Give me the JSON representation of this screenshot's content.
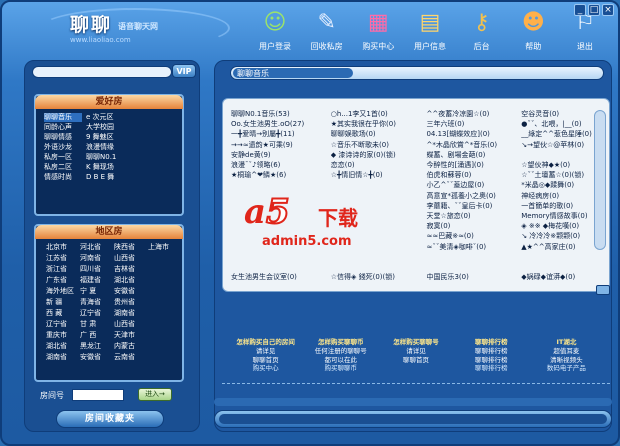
{
  "app": {
    "logo": "聊聊",
    "logo_sub": "语音聊天网",
    "logo_url": "www.liaoliao.com"
  },
  "toolbar": {
    "items": [
      {
        "label": "用户登录",
        "icon": "user-login-icon",
        "glyph": "☺"
      },
      {
        "label": "回收私房",
        "icon": "chair-icon",
        "glyph": "✎"
      },
      {
        "label": "购买中心",
        "icon": "shopping-bag-icon",
        "glyph": "▦"
      },
      {
        "label": "用户信息",
        "icon": "user-info-icon",
        "glyph": "▤"
      },
      {
        "label": "后台",
        "icon": "keys-icon",
        "glyph": "⚷"
      },
      {
        "label": "帮助",
        "icon": "help-icon",
        "glyph": "☻"
      },
      {
        "label": "退出",
        "icon": "exit-icon",
        "glyph": "⚐"
      }
    ]
  },
  "window": {
    "minimize": "_",
    "maximize": "□",
    "close": "×"
  },
  "left": {
    "vip": "VIP",
    "hobby_title": "爱好房",
    "hobby_rooms": [
      "聊聊音乐",
      "e 次元区",
      "同龄心声",
      "大学校园",
      "聊聊情感",
      "9 舞魅区",
      "外语沙龙",
      "浪漫情缘",
      "私房一区",
      "聊聊N0.1",
      "私房二区",
      "K 舞现场",
      "情感时尚",
      "D B E 舞"
    ],
    "region_title": "地区房",
    "region_rooms": [
      "北京市",
      "河北省",
      "陕西省",
      "上海市",
      "江苏省",
      "河南省",
      "山西省",
      "",
      "浙江省",
      "四川省",
      "吉林省",
      "",
      "广东省",
      "福建省",
      "湖北省",
      "",
      "海外地区",
      "宁 夏",
      "安徽省",
      "",
      "新 疆",
      "青海省",
      "贵州省",
      "",
      "西 藏",
      "辽宁省",
      "湖南省",
      "",
      "辽宁省",
      "甘 肃",
      "山西省",
      "",
      "重庆市",
      "广 西",
      "天津市",
      "",
      "湖北省",
      "黑龙江",
      "内蒙古",
      "",
      "湖南省",
      "安徽省",
      "云南省",
      ""
    ],
    "room_label": "房间号",
    "enter_button": "进入→",
    "favorites": "房间收藏夹"
  },
  "right": {
    "title": "聊聊音乐",
    "rooms": [
      [
        "聊聊N0.1音乐(53)",
        "Oo.女生池男生.oO(27)",
        "一╋爱晴→别屬╋(11)",
        "→→≈遗韵★可乘(9)",
        "安静de黄(9)",
        "浪漫ˉˇ♪领略(6)",
        "★桐瑜^❤鳞★(6)",
        "",
        "",
        "",
        "",
        "",
        "",
        "",
        "",
        "",
        "女生池男生会议室(0)"
      ],
      [
        "○h...1李又1首(0)",
        "★其实我很在乎你(0)",
        "聊聊娱歌场(0)",
        "☆音乐不断歌未(0)",
        "◆ 漆诗诗的家(0)(锁)",
        "恋恋(0)",
        "☆╋情旧情☆╋(0)",
        "",
        "",
        "",
        "",
        "",
        "",
        "",
        "",
        "",
        "☆信得◈ 錢死(0)(锁)"
      ],
      [
        "^^夜蓄冷凉園☆(0)",
        "三年六班(0)",
        "04.13[蝴蝶效应](0)",
        "^*木晶欣賞^*音乐(0)",
        "蝶蓄、剧場金葩(0)",
        "今醉性的[涌遇](0)",
        "伯虎和蘇蓉(0)",
        "小乙^ˇˇ蓋边屋(0)",
        "高意宣*孤養小之奧(0)",
        "李蘑籍、ˇˇ皇后卡(0)",
        "天堂☆旅恋(0)",
        "寂寞(0)",
        "≈≈巴藏※≈(0)",
        "≈ˇˇ美清◈咖啡ˇ(0)",
        "",
        "",
        "中国民乐3(0)"
      ],
      [
        "空谷灵音(0)",
        "●ˇˇ、北喂，|__(0)",
        "__綠定^^惹色星陲(0)",
        "↘→望伙☆@苹林(0)",
        "",
        "☆望伙神◆★(0)",
        "☆ˇˇ土壇蓄☆(0)(锁)",
        "*米晶◎◆蹂舞(0)",
        "神经病房(0)",
        "一首簡单的歌(0)",
        "Memory情感故事(0)",
        "◈ ※※ ◆梅花嘆(0)",
        "↘ 冷冷冷※颗颗(0)",
        "▲★^^高家庄(0)",
        "",
        "",
        "◆娲碌◆谊漭◆(0)"
      ]
    ],
    "services": [
      {
        "head": "怎样购买自己的房间",
        "lines": [
          "请详见",
          "聊聊首页"
        ],
        "foot": "购买中心"
      },
      {
        "head": "怎样购买聊聊币",
        "lines": [
          "任何注册的聊聊号",
          "都可以在此"
        ],
        "foot": "购买聊聊币"
      },
      {
        "head": "怎样购买聊聊号",
        "lines": [
          "请详见",
          "聊聊首页"
        ],
        "foot": ""
      },
      {
        "head": "聊聊排行榜",
        "lines": [
          "聊聊排行榜",
          "聊聊排行榜"
        ],
        "foot": "聊聊排行榜"
      },
      {
        "head": "IT湖北",
        "lines": [
          "超值耳麦",
          "清晰视频头"
        ],
        "foot": "数码电子产品"
      }
    ]
  },
  "watermark": {
    "brand_a": "a",
    "brand_5": "5",
    "brand_cn": "下载",
    "url": "admin5.com"
  },
  "colors": {
    "accent": "#2f78c6",
    "panel": "#1a4f92",
    "title_orange": "#e6833a",
    "watermark_red": "#e0261b"
  }
}
